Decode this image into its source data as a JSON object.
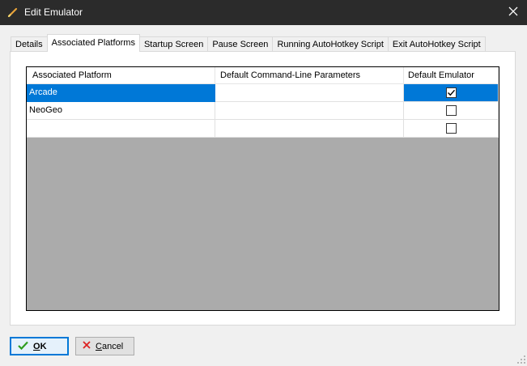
{
  "window": {
    "title": "Edit Emulator",
    "icon": "pencil-icon",
    "close_icon": "close-icon"
  },
  "tabs": [
    {
      "label": "Details",
      "active": false
    },
    {
      "label": "Associated Platforms",
      "active": true
    },
    {
      "label": "Startup Screen",
      "active": false
    },
    {
      "label": "Pause Screen",
      "active": false
    },
    {
      "label": "Running AutoHotkey Script",
      "active": false
    },
    {
      "label": "Exit AutoHotkey Script",
      "active": false
    }
  ],
  "grid": {
    "columns": [
      "Associated Platform",
      "Default Command-Line Parameters",
      "Default Emulator"
    ],
    "rows": [
      {
        "platform": "Arcade",
        "params": "",
        "default": true,
        "selected": true
      },
      {
        "platform": "NeoGeo",
        "params": "",
        "default": false,
        "selected": false
      },
      {
        "platform": "",
        "params": "",
        "default": false,
        "selected": false
      }
    ],
    "selection_color": "#0078d7"
  },
  "buttons": {
    "ok": {
      "label": "OK",
      "accel": "O",
      "rest": "K",
      "icon": "checkmark-icon",
      "icon_color": "#2e9d1f"
    },
    "cancel": {
      "label": "Cancel",
      "accel": "C",
      "rest": "ancel",
      "icon": "x-icon",
      "icon_color": "#d22"
    }
  }
}
